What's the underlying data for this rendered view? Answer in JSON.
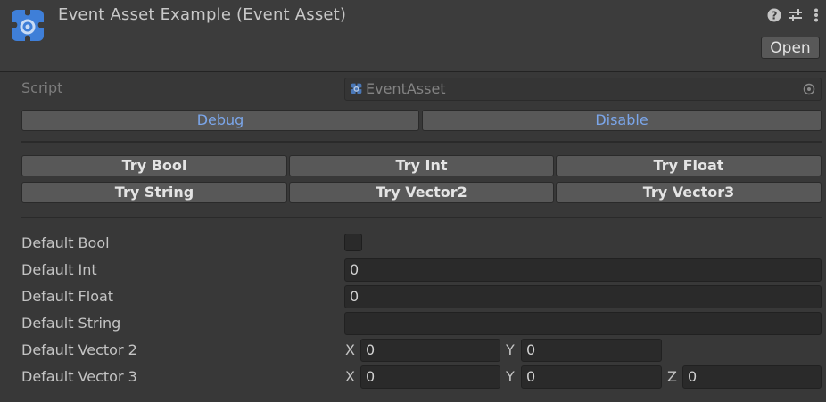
{
  "header": {
    "title": "Event Asset Example (Event Asset)",
    "open_label": "Open",
    "icons": [
      "help-icon",
      "settings-sliders-icon",
      "more-vertical-icon"
    ]
  },
  "script": {
    "label": "Script",
    "value": "EventAsset"
  },
  "mode_buttons": {
    "debug": "Debug",
    "disable": "Disable"
  },
  "try_buttons": {
    "bool": "Try Bool",
    "int": "Try Int",
    "float": "Try Float",
    "string": "Try String",
    "vector2": "Try Vector2",
    "vector3": "Try Vector3"
  },
  "fields": {
    "bool": {
      "label": "Default Bool",
      "checked": false
    },
    "int": {
      "label": "Default Int",
      "value": "0"
    },
    "float": {
      "label": "Default Float",
      "value": "0"
    },
    "string": {
      "label": "Default String",
      "value": ""
    },
    "vector2": {
      "label": "Default Vector 2",
      "x": "0",
      "y": "0"
    },
    "vector3": {
      "label": "Default Vector 3",
      "x": "0",
      "y": "0",
      "z": "0"
    }
  },
  "axis_labels": {
    "x": "X",
    "y": "Y",
    "z": "Z"
  },
  "colors": {
    "accent_blue": "#7ba6ea",
    "asset_icon_blue": "#3f7fd8"
  }
}
